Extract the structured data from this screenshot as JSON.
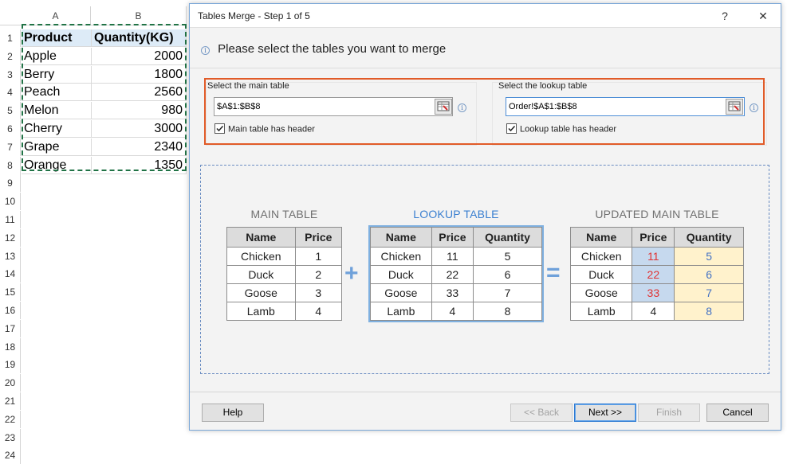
{
  "sheet": {
    "columns": [
      "A",
      "B"
    ],
    "rows": [
      "1",
      "2",
      "3",
      "4",
      "5",
      "6",
      "7",
      "8",
      "9",
      "10",
      "11",
      "12",
      "13",
      "14",
      "15",
      "16",
      "17",
      "18",
      "19",
      "20",
      "21",
      "22",
      "23",
      "24"
    ],
    "header": [
      "Product",
      "Quantity(KG)"
    ],
    "data": [
      [
        "Apple",
        "2000"
      ],
      [
        "Berry",
        "1800"
      ],
      [
        "Peach",
        "2560"
      ],
      [
        "Melon",
        "980"
      ],
      [
        "Cherry",
        "3000"
      ],
      [
        "Grape",
        "2340"
      ],
      [
        "Orange",
        "1350"
      ]
    ]
  },
  "dialog": {
    "title": "Tables Merge - Step 1 of 5",
    "help_glyph": "?",
    "close_glyph": "✕",
    "intro": "Please select the tables you want to merge",
    "main": {
      "label": "Select the main table",
      "value": "$A$1:$B$8",
      "checkbox_label": "Main table has header",
      "checked": true
    },
    "lookup": {
      "label": "Select the lookup table",
      "value": "Order!$A$1:$B$8",
      "checkbox_label": "Lookup table has header",
      "checked": true
    },
    "preview": {
      "main_title": "MAIN TABLE",
      "lookup_title": "LOOKUP TABLE",
      "updated_title": "UPDATED MAIN TABLE",
      "plus": "+",
      "equals": "=",
      "main_table": {
        "headers": [
          "Name",
          "Price"
        ],
        "rows": [
          [
            "Chicken",
            "1"
          ],
          [
            "Duck",
            "2"
          ],
          [
            "Goose",
            "3"
          ],
          [
            "Lamb",
            "4"
          ]
        ]
      },
      "lookup_table": {
        "headers": [
          "Name",
          "Price",
          "Quantity"
        ],
        "rows": [
          [
            "Chicken",
            "11",
            "5"
          ],
          [
            "Duck",
            "22",
            "6"
          ],
          [
            "Goose",
            "33",
            "7"
          ],
          [
            "Lamb",
            "4",
            "8"
          ]
        ]
      },
      "updated_table": {
        "headers": [
          "Name",
          "Price",
          "Quantity"
        ],
        "rows": [
          [
            "Chicken",
            "11",
            "5"
          ],
          [
            "Duck",
            "22",
            "6"
          ],
          [
            "Goose",
            "33",
            "7"
          ],
          [
            "Lamb",
            "4",
            "8"
          ]
        ]
      }
    },
    "buttons": {
      "help": "Help",
      "back": "<< Back",
      "next": "Next >>",
      "finish": "Finish",
      "cancel": "Cancel"
    },
    "colors": {
      "highlight_border": "#e15b28",
      "preview_border": "#6b8dc2",
      "lookup_title": "#3a7fd0",
      "updated_price_bg": "#c6d9ee",
      "updated_qty_bg": "#fff2cc",
      "updated_price_text": "#e03333",
      "updated_qty_text": "#4472c4"
    }
  }
}
